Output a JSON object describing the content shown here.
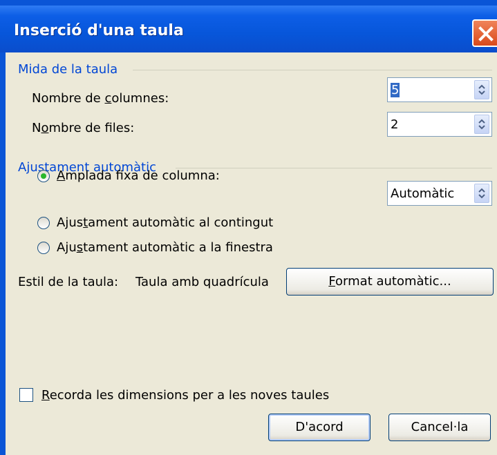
{
  "dialog": {
    "title": "Inserció d'una taula"
  },
  "table_size": {
    "group_label": "Mida de la taula",
    "columns_label_pre": "Nombre de ",
    "columns_label_key": "c",
    "columns_label_post": "olumnes:",
    "columns_value": "5",
    "rows_label_pre": "N",
    "rows_label_key": "o",
    "rows_label_post": "mbre de files:",
    "rows_value": "2"
  },
  "autofit": {
    "group_label": "Ajustament automàtic",
    "fixed_width_key": "A",
    "fixed_width_post": "mplada fixa de columna:",
    "fixed_width_value": "Automàtic",
    "contents_pre": "Ajus",
    "contents_key": "t",
    "contents_post": "ament automàtic al contingut",
    "window_pre": "Aju",
    "window_key": "s",
    "window_post": "tament automàtic a la finestra",
    "selected": "fixed_width"
  },
  "style": {
    "label": "Estil de la taula:",
    "value": "Taula amb quadrícula",
    "autoformat_key": "F",
    "autoformat_post": "ormat automàtic..."
  },
  "remember": {
    "key": "R",
    "post": "ecorda les dimensions per a les noves taules",
    "checked": false
  },
  "buttons": {
    "ok": "D'acord",
    "cancel": "Cancel·la"
  },
  "icons": {
    "close": "close-icon",
    "spin": "spin-arrows-icon"
  },
  "colors": {
    "titlebar": "#0a55d6",
    "group_label": "#0046d5",
    "close_button": "#e05a2b",
    "radio_dot": "#2bb72b"
  }
}
